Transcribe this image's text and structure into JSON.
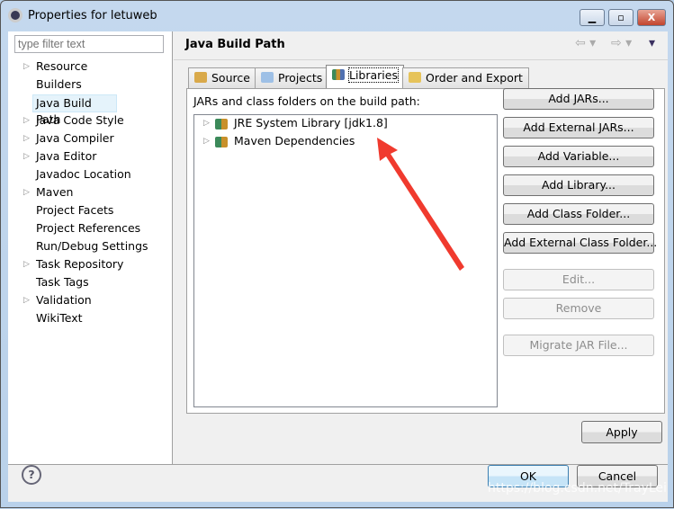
{
  "window": {
    "title": "Properties for letuweb",
    "controls": [
      "minimize",
      "maximize",
      "close"
    ]
  },
  "filter": {
    "placeholder": "type filter text"
  },
  "nav": {
    "items": [
      {
        "label": "Resource",
        "expandable": true
      },
      {
        "label": "Builders",
        "expandable": false
      },
      {
        "label": "Java Build Path",
        "expandable": false,
        "selected": true
      },
      {
        "label": "Java Code Style",
        "expandable": true
      },
      {
        "label": "Java Compiler",
        "expandable": true
      },
      {
        "label": "Java Editor",
        "expandable": true
      },
      {
        "label": "Javadoc Location",
        "expandable": false
      },
      {
        "label": "Maven",
        "expandable": true
      },
      {
        "label": "Project Facets",
        "expandable": false
      },
      {
        "label": "Project References",
        "expandable": false
      },
      {
        "label": "Run/Debug Settings",
        "expandable": false
      },
      {
        "label": "Task Repository",
        "expandable": true
      },
      {
        "label": "Task Tags",
        "expandable": false
      },
      {
        "label": "Validation",
        "expandable": true
      },
      {
        "label": "WikiText",
        "expandable": false
      }
    ]
  },
  "header": {
    "title": "Java Build Path"
  },
  "tabs": [
    {
      "label": "Source"
    },
    {
      "label": "Projects"
    },
    {
      "label": "Libraries",
      "active": true
    },
    {
      "label": "Order and Export"
    }
  ],
  "libraries": {
    "label": "JARs and class folders on the build path:",
    "tree": [
      {
        "label": "JRE System Library [jdk1.8]"
      },
      {
        "label": "Maven Dependencies"
      }
    ],
    "buttons": [
      {
        "label": "Add JARs...",
        "enabled": true
      },
      {
        "label": "Add External JARs...",
        "enabled": true
      },
      {
        "label": "Add Variable...",
        "enabled": true
      },
      {
        "label": "Add Library...",
        "enabled": true
      },
      {
        "label": "Add Class Folder...",
        "enabled": true
      },
      {
        "label": "Add External Class Folder...",
        "enabled": true
      },
      {
        "label": "Edit...",
        "enabled": false
      },
      {
        "label": "Remove",
        "enabled": false
      },
      {
        "label": "Migrate JAR File...",
        "enabled": false
      }
    ]
  },
  "footer": {
    "apply": "Apply",
    "ok": "OK",
    "cancel": "Cancel",
    "help": "?"
  },
  "watermark": "https://blog.csdn.net/TrayLei",
  "colors": {
    "arrow": "#f03a2e",
    "selection": "#e5f3fb"
  }
}
